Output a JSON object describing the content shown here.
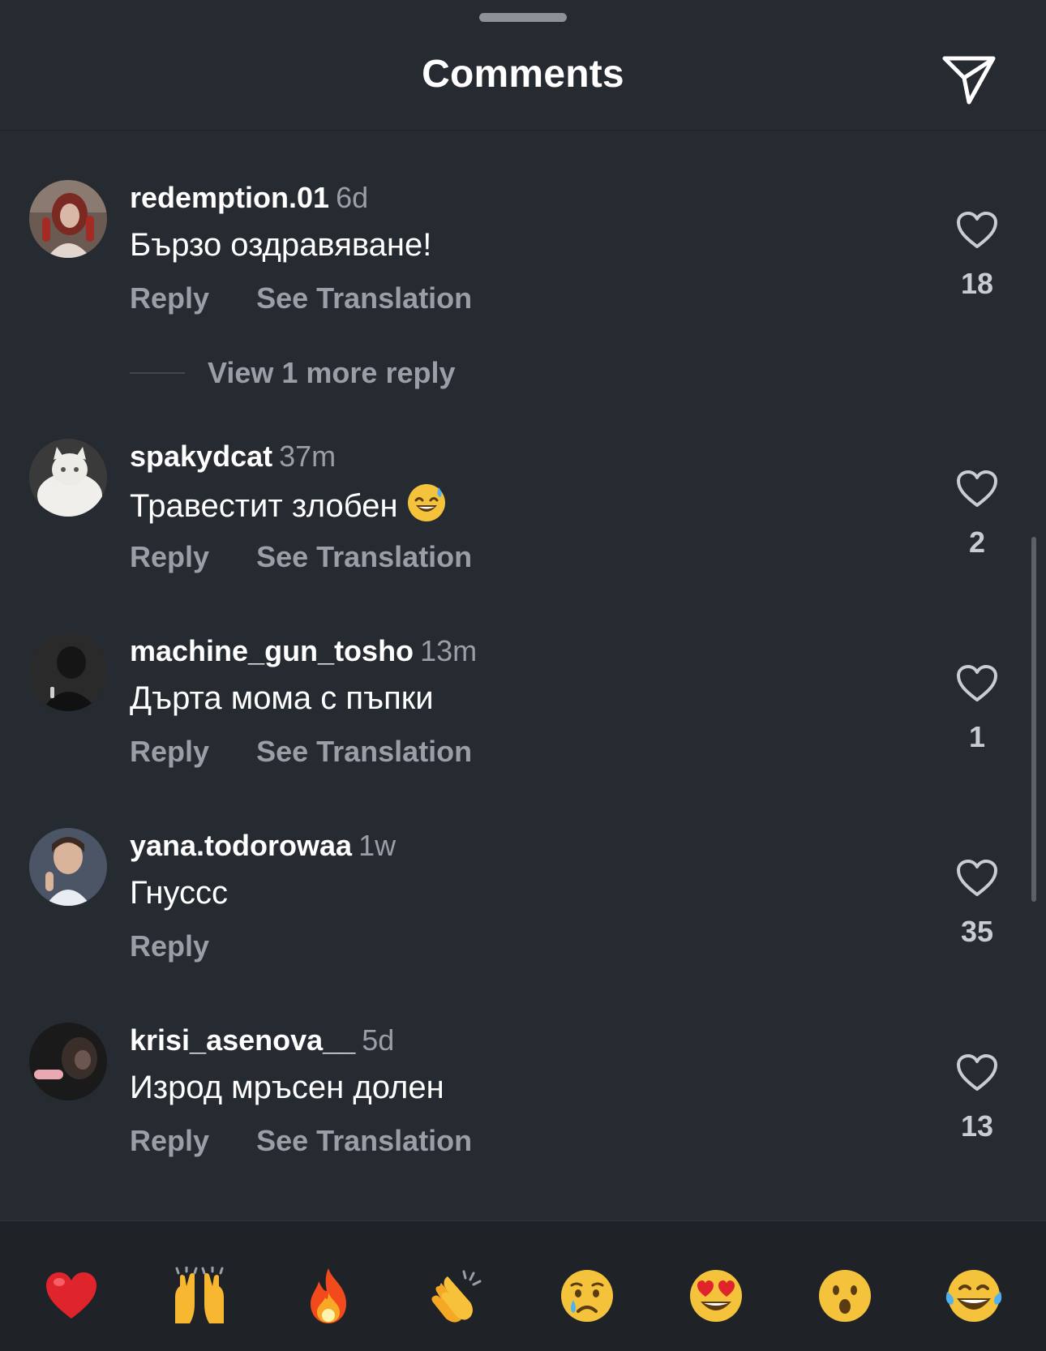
{
  "header": {
    "title": "Comments",
    "share_icon": "paper-plane-icon"
  },
  "comments": [
    {
      "username": "redemption.01",
      "time": "6d",
      "text": "Бързо оздравяване!",
      "reply_label": "Reply",
      "translate_label": "See Translation",
      "likes": "18",
      "view_replies": "View 1 more reply"
    },
    {
      "username": "spakydcat",
      "time": "37m",
      "text": "Травестит злобен",
      "emoji": "grinning-sweat-emoji",
      "reply_label": "Reply",
      "translate_label": "See Translation",
      "likes": "2"
    },
    {
      "username": "machine_gun_tosho",
      "time": "13m",
      "text": "Дърта мома с пъпки",
      "reply_label": "Reply",
      "translate_label": "See Translation",
      "likes": "1"
    },
    {
      "username": "yana.todorowaa",
      "time": "1w",
      "text": "Гнуссс",
      "reply_label": "Reply",
      "likes": "35"
    },
    {
      "username": "krisi_asenova__",
      "time": "5d",
      "text": "Изрод мръсен долен",
      "reply_label": "Reply",
      "translate_label": "See Translation",
      "likes": "13"
    }
  ],
  "reactions": [
    "red-heart-emoji",
    "raising-hands-emoji",
    "fire-emoji",
    "clapping-hands-emoji",
    "crying-face-emoji",
    "heart-eyes-emoji",
    "surprised-face-emoji",
    "tears-of-joy-emoji"
  ],
  "colors": {
    "background": "#262a31",
    "reaction_bar": "#1f2227",
    "secondary_text": "#9a9ea6"
  }
}
